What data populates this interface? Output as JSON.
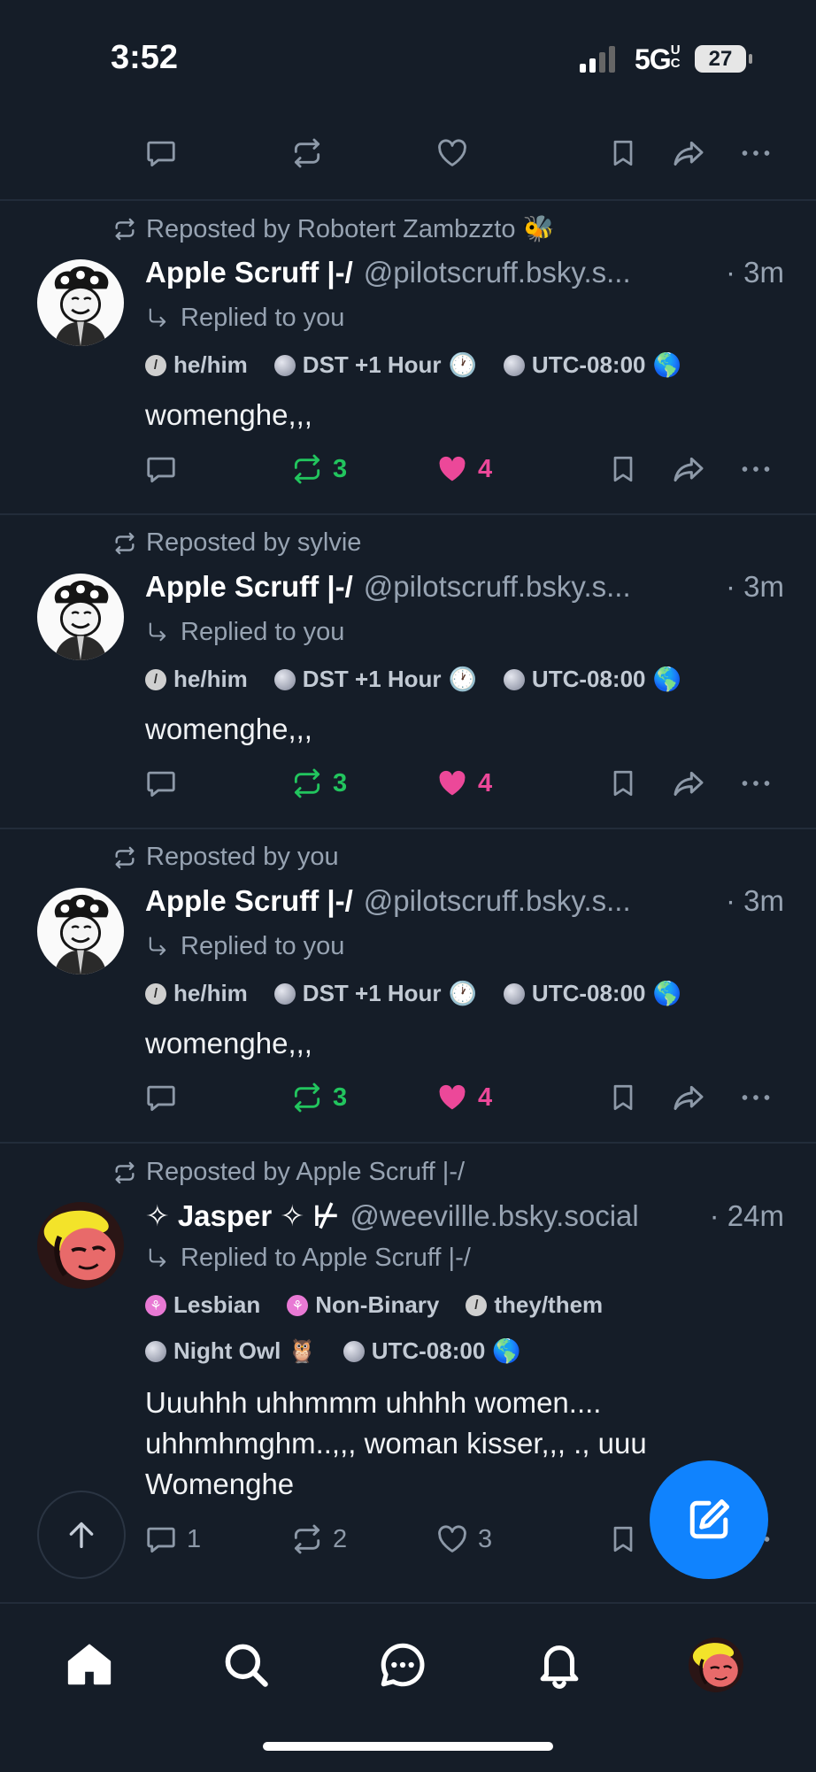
{
  "status_bar": {
    "time": "3:52",
    "network": "5G",
    "network_suffix": "UC",
    "battery": "27"
  },
  "posts": [
    {
      "repost_label": "Reposted by Robotert Zambzzto 🐝",
      "author_name": "Apple Scruff |-/",
      "handle": "@pilotscruff.bsky.s...",
      "time": "· 3m",
      "reply_label": "Replied to you",
      "badges": [
        {
          "dot": "/",
          "text": "he/him",
          "emoji": ""
        },
        {
          "dot": "",
          "text": "DST +1 Hour",
          "emoji": "🕐"
        },
        {
          "dot": "",
          "text": "UTC-08:00",
          "emoji": "🌎"
        }
      ],
      "text": "womenghe,,,",
      "reply_count": "",
      "repost_count": "3",
      "like_count": "4"
    },
    {
      "repost_label": "Reposted by sylvie",
      "author_name": "Apple Scruff |-/",
      "handle": "@pilotscruff.bsky.s...",
      "time": "· 3m",
      "reply_label": "Replied to you",
      "badges": [
        {
          "dot": "/",
          "text": "he/him",
          "emoji": ""
        },
        {
          "dot": "",
          "text": "DST +1 Hour",
          "emoji": "🕐"
        },
        {
          "dot": "",
          "text": "UTC-08:00",
          "emoji": "🌎"
        }
      ],
      "text": "womenghe,,,",
      "reply_count": "",
      "repost_count": "3",
      "like_count": "4"
    },
    {
      "repost_label": "Reposted by you",
      "author_name": "Apple Scruff |-/",
      "handle": "@pilotscruff.bsky.s...",
      "time": "· 3m",
      "reply_label": "Replied to you",
      "badges": [
        {
          "dot": "/",
          "text": "he/him",
          "emoji": ""
        },
        {
          "dot": "",
          "text": "DST +1 Hour",
          "emoji": "🕐"
        },
        {
          "dot": "",
          "text": "UTC-08:00",
          "emoji": "🌎"
        }
      ],
      "text": "womenghe,,,",
      "reply_count": "",
      "repost_count": "3",
      "like_count": "4"
    },
    {
      "repost_label": "Reposted by Apple Scruff |-/",
      "author_name": "✧ Jasper ✧ ⊬",
      "handle": "@weevillle.bsky.social",
      "time": "· 24m",
      "reply_label": "Replied to Apple Scruff |-/",
      "badges_row1": [
        {
          "dot": "⚘",
          "text": "Lesbian",
          "emoji": ""
        },
        {
          "dot": "⚘",
          "text": "Non-Binary",
          "emoji": ""
        },
        {
          "dot": "/",
          "text": "they/them",
          "emoji": ""
        }
      ],
      "badges_row2": [
        {
          "dot": "",
          "text": "Night Owl",
          "emoji": "🦉"
        },
        {
          "dot": "",
          "text": "UTC-08:00",
          "emoji": "🌎"
        }
      ],
      "text": "Uuuhhh uhhmmm uhhhh women.... uhhmhmghm..,,, woman kisser,,, ., uuu Womenghe",
      "reply_count": "1",
      "repost_count": "2",
      "like_count": "3"
    }
  ],
  "colors": {
    "background": "#151d28",
    "repost_active": "#22c55e",
    "like_active": "#ec4899",
    "accent": "#1083fe"
  },
  "icons": {
    "action_bar": [
      "reply-icon",
      "repost-icon",
      "like-icon",
      "bookmark-icon",
      "share-icon",
      "more-icon"
    ],
    "tab_bar": [
      "home-icon",
      "search-icon",
      "chat-icon",
      "bell-icon",
      "profile-avatar"
    ],
    "floating": [
      "scroll-to-top-icon",
      "compose-icon"
    ]
  }
}
